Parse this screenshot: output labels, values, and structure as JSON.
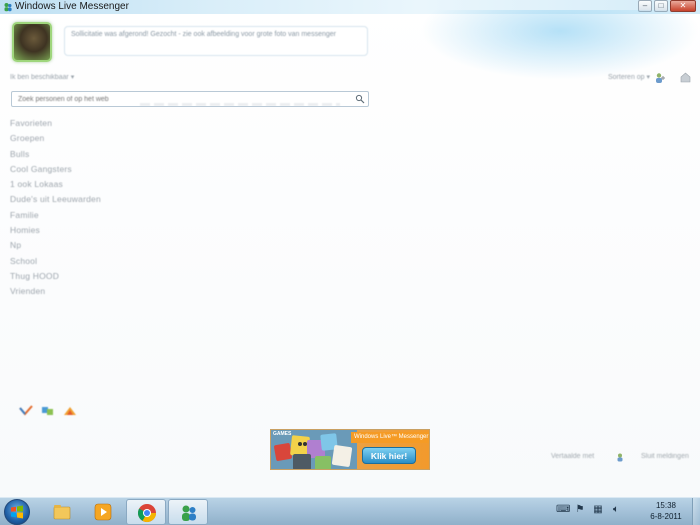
{
  "window": {
    "title": "Windows Live Messenger",
    "controls": {
      "minimize": "–",
      "maximize": "□",
      "close": "✕"
    }
  },
  "profile": {
    "status_message": "Sollicitatie was afgerond! Gezocht - zie ook afbeelding voor grote foto van messenger",
    "status_link": "",
    "status_menu": "Ik ben beschikbaar ▾",
    "sort_menu": "Sorteren op ▾"
  },
  "search": {
    "placeholder": "Zoek personen of op het web"
  },
  "groups": [
    "Favorieten",
    "Groepen",
    "Bulls",
    "Cool Gangsters",
    "1 ook Lokaas",
    "Dude's uit Leeuwarden",
    "Familie",
    "Homies",
    "Np",
    "School",
    "Thug HOOD",
    "Vrienden"
  ],
  "ad": {
    "logo": "GAMES",
    "header": "Windows Live™ Messenger",
    "button": "Klik hier!"
  },
  "footer": {
    "left": "Vertaalde met",
    "right": "Sluit meldingen"
  },
  "taskbar": {
    "time": "15:38",
    "date": "6-8-2011"
  },
  "colors": {
    "accent": "#1f5fa5",
    "avatar_border": "#9fd67c",
    "ad_orange": "#f59b25",
    "ad_button": "#2a8ec5"
  }
}
